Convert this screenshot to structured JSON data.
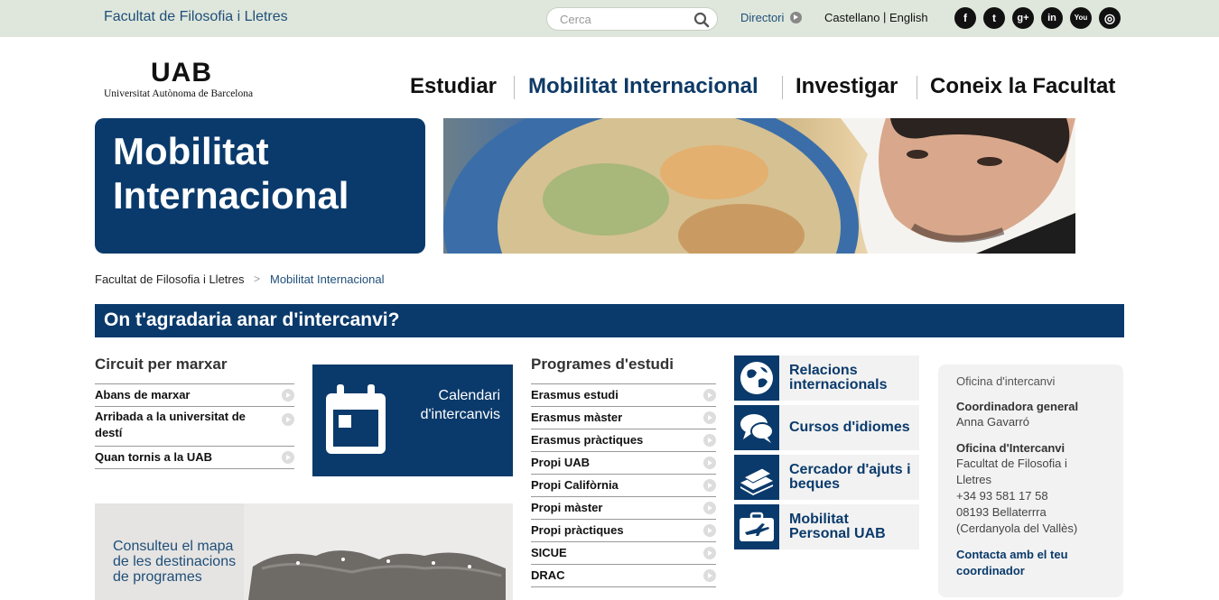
{
  "topbar": {
    "faculty": "Facultat de Filosofia i Lletres",
    "search_placeholder": "Cerca",
    "directory": "Directori",
    "languages": [
      "Castellano",
      "English"
    ],
    "social": [
      {
        "name": "facebook-icon",
        "glyph": "f"
      },
      {
        "name": "twitter-icon",
        "glyph": "t"
      },
      {
        "name": "google-plus-icon",
        "glyph": "g+"
      },
      {
        "name": "linkedin-icon",
        "glyph": "in"
      },
      {
        "name": "youtube-icon",
        "glyph": "You"
      },
      {
        "name": "instagram-icon",
        "glyph": "◎"
      }
    ]
  },
  "header": {
    "logo_mark": "UAB",
    "logo_text": "Universitat Autònoma de Barcelona",
    "nav": [
      "Estudiar",
      "Mobilitat Internacional",
      "Investigar",
      "Coneix la Facultat"
    ]
  },
  "hero": {
    "title_line1": "Mobilitat",
    "title_line2": "Internacional"
  },
  "breadcrumb": {
    "home": "Facultat de Filosofia i Lletres",
    "separator": ">",
    "current": "Mobilitat Internacional"
  },
  "section": {
    "title": "On t'agradaria anar d'intercanvi?"
  },
  "circuit": {
    "title": "Circuit per marxar",
    "items": [
      "Abans de marxar",
      "Arribada a la universitat de destí",
      "Quan tornis a la UAB"
    ]
  },
  "calendar": {
    "label": "Calendari d'intercanvis"
  },
  "map_promo": {
    "text": "Consulteu el mapa de les destinacions de programes"
  },
  "programs": {
    "title": "Programes d'estudi",
    "items": [
      "Erasmus estudi",
      "Erasmus màster",
      "Erasmus pràctiques",
      "Propi UAB",
      "Propi Califòrnia",
      "Propi màster",
      "Propi pràctiques",
      "SICUE",
      "DRAC"
    ]
  },
  "tiles": [
    {
      "label_1": "Relacions",
      "label_2": "internacionals",
      "icon": "globe-icon"
    },
    {
      "label_1": "Cursos d'idiomes",
      "label_2": "",
      "icon": "speech-bubbles-icon"
    },
    {
      "label_1": "Cercador d'ajuts i",
      "label_2": "beques",
      "icon": "money-icon"
    },
    {
      "label_1": "Mobilitat",
      "label_2": "Personal UAB",
      "icon": "airplane-icon"
    }
  ],
  "contact": {
    "heading": "Oficina d'intercanvi",
    "coord_title": "Coordinadora general",
    "coord_name": "Anna Gavarró",
    "office_title": "Oficina d'Intercanvi",
    "office_line1": "Facultat de Filosofia i",
    "office_line2": "Lletres",
    "phone": "+34 93 581 17 58",
    "postcode": "08193 Bellaterrra",
    "city": "(Cerdanyola del Vallès)",
    "link": "Contacta amb el teu coordinador"
  },
  "colors": {
    "brand_blue": "#0a3a6b",
    "topbar_bg": "#dfe7dc"
  }
}
